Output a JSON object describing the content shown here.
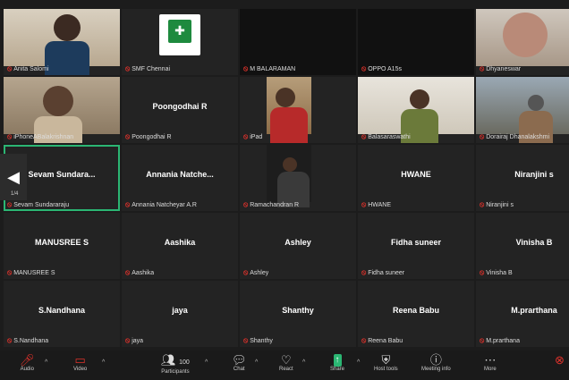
{
  "page_indicator": "1/4",
  "participants": [
    {
      "label": "Anita Salomi",
      "type": "video"
    },
    {
      "label": "SMF Chennai",
      "type": "logo"
    },
    {
      "label": "M BALARAMAN",
      "type": "blank"
    },
    {
      "label": "OPPO A15s",
      "type": "blank"
    },
    {
      "label": "Dhyaneswar",
      "type": "video"
    },
    {
      "label": "iPhoneABalakrishnan",
      "type": "video"
    },
    {
      "label": "Poongodhai R",
      "name": "Poongodhai R",
      "type": "name"
    },
    {
      "label": "iPad",
      "type": "video"
    },
    {
      "label": "Balasaraswathi",
      "type": "video"
    },
    {
      "label": "Dorairaj Dhanalakshmi",
      "type": "video"
    },
    {
      "label": "Sevam Sundararaju",
      "name": "Sevam Sundara...",
      "type": "name",
      "active": true
    },
    {
      "label": "Annania Natcheyar A.R",
      "name": "Annania Natche...",
      "type": "name"
    },
    {
      "label": "Ramachandran R",
      "type": "video"
    },
    {
      "label": "HWANE",
      "name": "HWANE",
      "type": "name"
    },
    {
      "label": "Niranjini s",
      "name": "Niranjini s",
      "type": "name"
    },
    {
      "label": "MANUSREE S",
      "name": "MANUSREE S",
      "type": "name"
    },
    {
      "label": "Aashika",
      "name": "Aashika",
      "type": "name"
    },
    {
      "label": "Ashley",
      "name": "Ashley",
      "type": "name"
    },
    {
      "label": "Fidha suneer",
      "name": "Fidha suneer",
      "type": "name"
    },
    {
      "label": "Vinisha B",
      "name": "Vinisha B",
      "type": "name"
    },
    {
      "label": "S.Nandhana",
      "name": "S.Nandhana",
      "type": "name"
    },
    {
      "label": "jaya",
      "name": "jaya",
      "type": "name"
    },
    {
      "label": "Shanthy",
      "name": "Shanthy",
      "type": "name"
    },
    {
      "label": "Reena Babu",
      "name": "Reena Babu",
      "type": "name"
    },
    {
      "label": "M.prarthana",
      "name": "M.prarthana",
      "type": "name"
    }
  ],
  "toolbar": {
    "audio": "Audio",
    "video": "Video",
    "participants": "Participants",
    "participants_count": "100",
    "chat": "Chat",
    "react": "React",
    "share": "Share",
    "host_tools": "Host tools",
    "meeting_info": "Meeting info",
    "more": "More"
  },
  "colors": {
    "active_border": "#2bb673",
    "mute": "#e0322b",
    "share": "#2bb673"
  }
}
